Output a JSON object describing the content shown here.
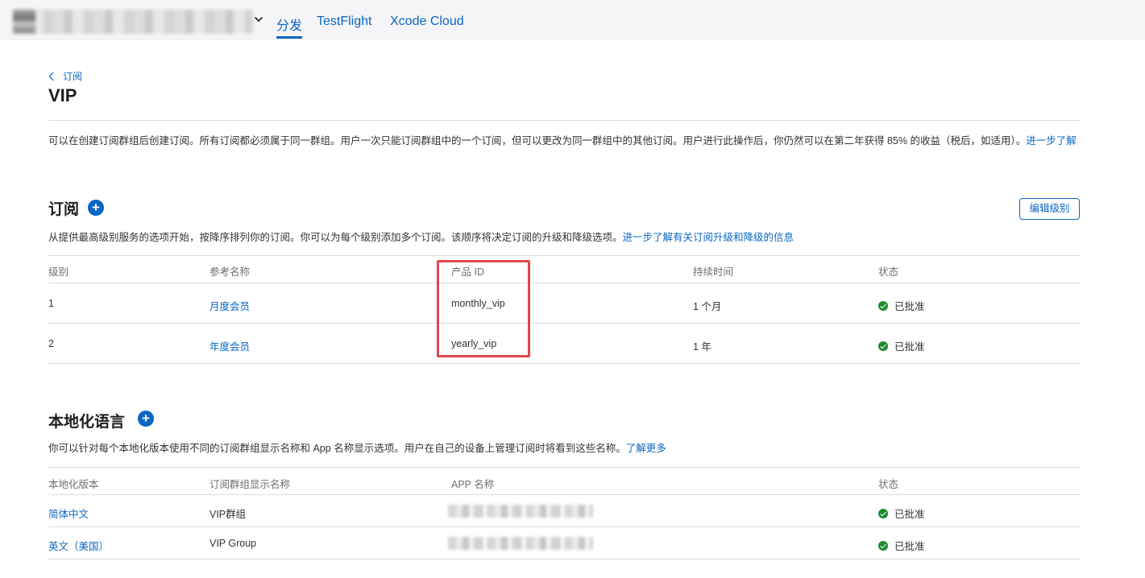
{
  "nav": {
    "tabs": [
      {
        "label": "分发"
      },
      {
        "label": "TestFlight"
      },
      {
        "label": "Xcode Cloud"
      }
    ]
  },
  "breadcrumb": {
    "label": "订阅"
  },
  "page": {
    "title": "VIP",
    "intro_text": "可以在创建订阅群组后创建订阅。所有订阅都必须属于同一群组。用户一次只能订阅群组中的一个订阅，但可以更改为同一群组中的其他订阅。用户进行此操作后，你仍然可以在第二年获得 85% 的收益（税后，如适用）。",
    "intro_link": "进一步了解"
  },
  "subscriptions": {
    "title": "订阅",
    "description": "从提供最高级别服务的选项开始，按降序排列你的订阅。你可以为每个级别添加多个订阅。该顺序将决定订阅的升级和降级选项。",
    "description_link": "进一步了解有关订阅升级和降级的信息",
    "edit_button": "编辑级别",
    "columns": [
      "级别",
      "参考名称",
      "产品 ID",
      "持续时间",
      "状态"
    ],
    "rows": [
      {
        "level": "1",
        "ref_name": "月度会员",
        "product_id": "monthly_vip",
        "duration": "1 个月",
        "status": "已批准"
      },
      {
        "level": "2",
        "ref_name": "年度会员",
        "product_id": "yearly_vip",
        "duration": "1 年",
        "status": "已批准"
      }
    ]
  },
  "localization": {
    "title": "本地化语言",
    "description": "你可以针对每个本地化版本使用不同的订阅群组显示名称和 App 名称显示选项。用户在自己的设备上管理订阅时将看到这些名称。",
    "description_link": "了解更多",
    "columns": [
      "本地化版本",
      "订阅群组显示名称",
      "APP 名称",
      "状态"
    ],
    "rows": [
      {
        "locale": "简体中文",
        "group_name": "VIP群组",
        "status": "已批准"
      },
      {
        "locale": "英文（美国）",
        "group_name": "VIP Group",
        "status": "已批准"
      }
    ]
  },
  "colors": {
    "accent": "#0a66c2",
    "highlight": "#e0474c",
    "approved": "#1f8a2e"
  }
}
